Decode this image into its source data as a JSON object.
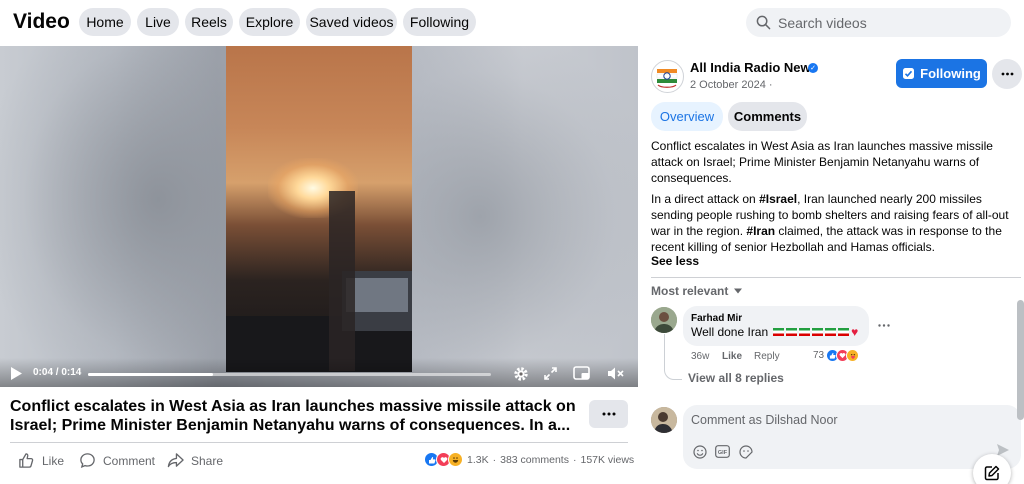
{
  "header": {
    "title": "Video",
    "nav": [
      {
        "label": "Home"
      },
      {
        "label": "Live"
      },
      {
        "label": "Reels"
      },
      {
        "label": "Explore"
      },
      {
        "label": "Saved videos"
      },
      {
        "label": "Following"
      }
    ],
    "search_placeholder": "Search videos"
  },
  "player": {
    "timecode": "0:04 / 0:14",
    "progress_fraction": 0.31,
    "controls": [
      "play-icon",
      "settings-icon",
      "fullscreen-icon",
      "miniplayer-icon",
      "mute-icon"
    ]
  },
  "video": {
    "title": "Conflict escalates in West Asia as Iran launches massive missile attack on Israel; Prime Minister Benjamin Netanyahu warns of consequences. In a...",
    "actions": {
      "like": "Like",
      "comment": "Comment",
      "share": "Share"
    },
    "reaction_count": "1.3K",
    "comments_count": "383 comments",
    "views_count": "157K views",
    "separator": "·"
  },
  "post": {
    "page_name": "All India Radio News",
    "date": "2 October 2024 ·",
    "follow_label": "Following",
    "tabs": [
      {
        "label": "Overview"
      },
      {
        "label": "Comments"
      }
    ],
    "description_headline": "Conflict escalates in West Asia as Iran launches massive missile attack on Israel; Prime Minister Benjamin Netanyahu warns of consequences.",
    "description_body": {
      "p1": "In a direct attack on ",
      "tag1": "#Israel",
      "p2": ", Iran launched nearly 200 missiles sending people rushing to bomb shelters and raising fears of all-out war in the region. ",
      "tag2": "#Iran",
      "p3": " claimed, the attack was in response to the recent killing of senior Hezbollah and Hamas officials."
    },
    "see_less": "See less"
  },
  "comments": {
    "sort_label": "Most relevant",
    "items": [
      {
        "author": "Farhad Mir",
        "text": "Well done Iran",
        "time": "36w",
        "like": "Like",
        "reply": "Reply",
        "reaction_count": "73"
      }
    ],
    "view_replies": "View all 8 replies",
    "composer_placeholder": "Comment as Dilshad Noor"
  },
  "colors": {
    "accent": "#1b74e4",
    "pill_bg": "#e4e6eb",
    "secondary_text": "#65676b"
  }
}
